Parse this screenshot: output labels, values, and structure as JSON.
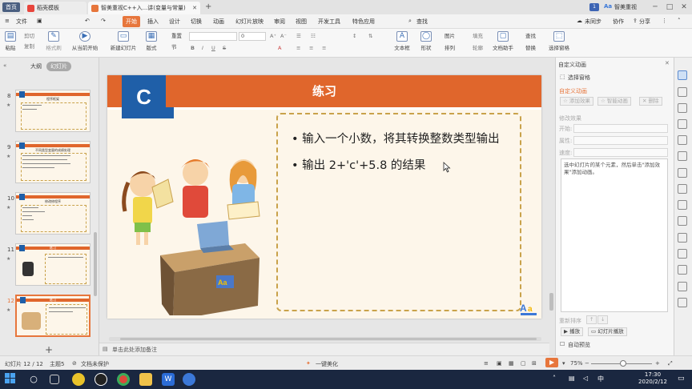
{
  "titlebar": {
    "home_badge": "首页",
    "tabs": [
      {
        "label": "稻壳模板"
      },
      {
        "label": "智美重视C++入...讲(变量与常量)"
      }
    ],
    "new_tab": "+",
    "page_badge": "1",
    "brand": "智美重视",
    "controls": [
      "─",
      "□",
      "✕"
    ]
  },
  "menubar": {
    "file_menu": "文件",
    "tabs": [
      "开始",
      "插入",
      "设计",
      "切换",
      "动画",
      "幻灯片放映",
      "审阅",
      "视图",
      "开发工具",
      "特色应用"
    ],
    "search": "查找",
    "cloud": "未同步",
    "collab": "协作",
    "share": "分享"
  },
  "ribbon": {
    "paste": "粘贴",
    "cut": "剪切",
    "copy": "复制",
    "format_painter": "格式刷",
    "from_current": "从当前开始",
    "new_slide": "新建幻灯片",
    "layout": "版式",
    "section": "节",
    "reset": "重置",
    "font_size_value": "0",
    "text_box": "文本框",
    "shape": "形状",
    "arrange": "排列",
    "picture": "图片",
    "fill": "填充",
    "doc_assistant": "文档助手",
    "find": "查找",
    "replace": "替换",
    "select_pane": "选择窗格",
    "outline": "轮廓"
  },
  "leftpanel": {
    "view_outline": "大纲",
    "view_slides": "幻灯片",
    "thumbnails": [
      {
        "num": "8",
        "title": "程序框架"
      },
      {
        "num": "9",
        "title": "不同类型变量的成绩处理"
      },
      {
        "num": "10",
        "title": "修改修程序"
      },
      {
        "num": "11",
        "title": "练习"
      },
      {
        "num": "12",
        "title": "练习"
      }
    ],
    "add_slide": "+"
  },
  "slide": {
    "letter": "C",
    "title": "练习",
    "bullets": [
      "输入一个小数，将其转换整数类型输出",
      "输出 2+'c'+5.8 的结果"
    ],
    "notes_placeholder": "单击此处添加备注"
  },
  "taskpane": {
    "title": "自定义动画",
    "select_pane": "选择窗格",
    "section": "自定义动画",
    "add_effect": "添加效果",
    "smart_anim": "智能动画",
    "delete": "删除",
    "modify": "修改效果",
    "start_label": "开始:",
    "property_label": "属性:",
    "speed_label": "速度:",
    "description": "选中幻灯片的某个元素，然后单击\"添加效果\"添加动画。",
    "reorder": "重新排序",
    "play": "播放",
    "slideshow": "幻灯片播放",
    "auto_preview": "自动预览"
  },
  "statusbar": {
    "slide_counter": "幻灯片 12 / 12",
    "theme": "主题5",
    "protection": "文档未保护",
    "beautify": "一键美化",
    "zoom": "75%",
    "zoom_minus": "−",
    "zoom_plus": "+"
  },
  "taskbar": {
    "time": "17:30",
    "date": "2020/2/12",
    "apps": [
      "start-icon",
      "search-icon",
      "task-view-icon",
      "player-icon",
      "qq-icon",
      "chrome-icon",
      "explorer-icon",
      "wps-writer-icon",
      "wps-ppt-icon"
    ]
  },
  "colors": {
    "accent": "#e7763c",
    "slide_band": "#e0662c",
    "slide_blue": "#1f5fa8",
    "slide_bg": "#fdf6ea",
    "dashed_border": "#c9a24a"
  }
}
